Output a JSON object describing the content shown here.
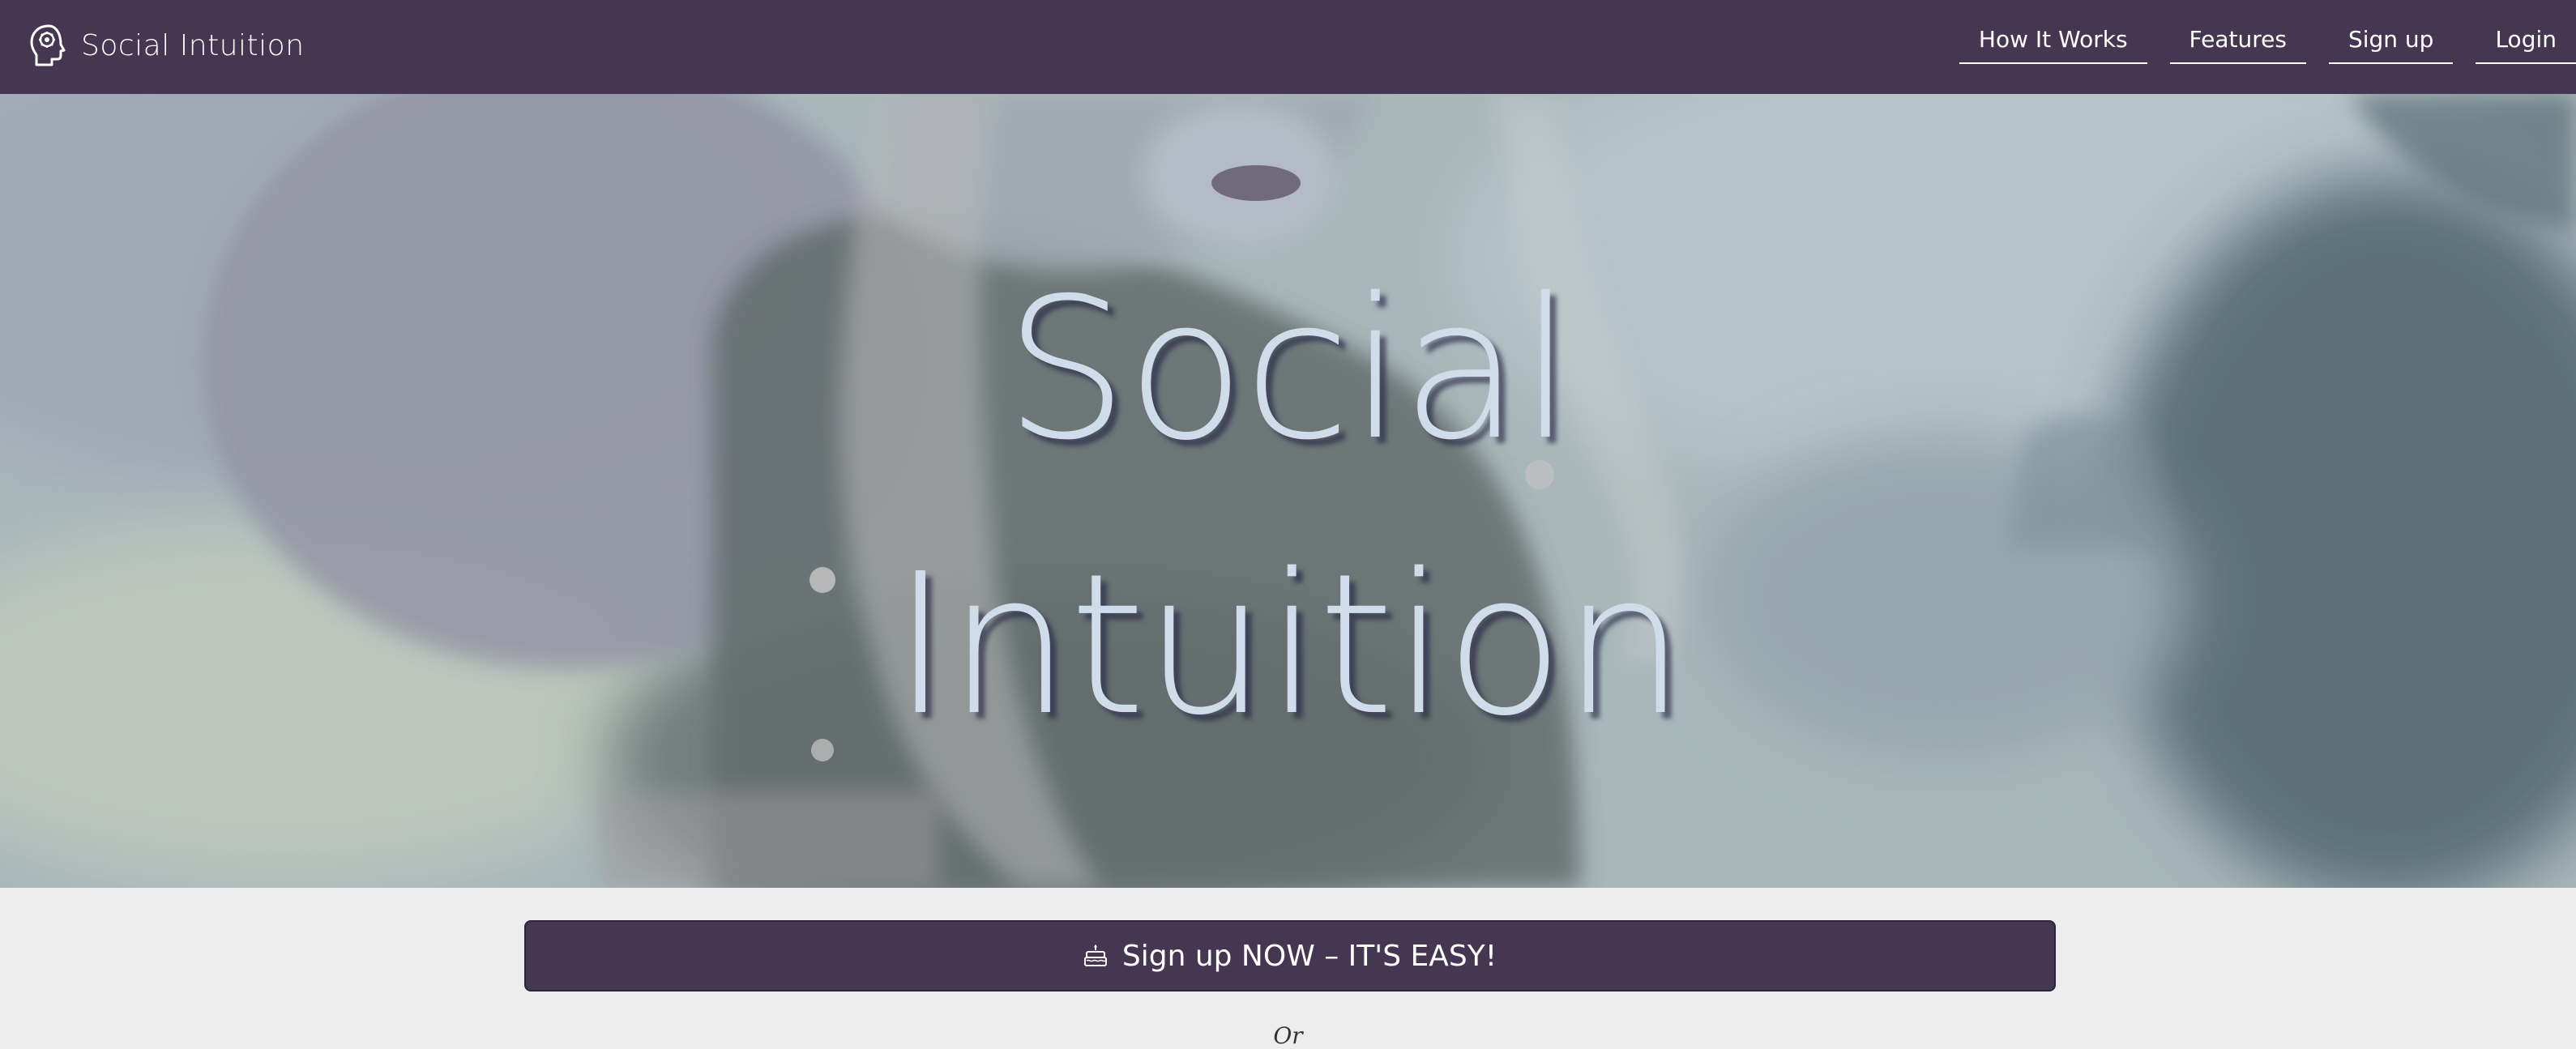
{
  "brand": {
    "name": "Social Intuition",
    "icon": "brain-head-icon"
  },
  "nav": {
    "items": [
      {
        "label": "How It Works"
      },
      {
        "label": "Features"
      },
      {
        "label": "Sign up"
      },
      {
        "label": "Login"
      }
    ]
  },
  "hero": {
    "title_line1": "Social",
    "title_line2": "Intuition"
  },
  "cta": {
    "label": "Sign up NOW – IT'S EASY!",
    "icon": "cake-icon"
  },
  "or_text": "Or",
  "colors": {
    "navbar_bg": "#453651",
    "page_bg": "#ededee",
    "hero_text": "#cfdcea",
    "button_bg": "#453651"
  }
}
